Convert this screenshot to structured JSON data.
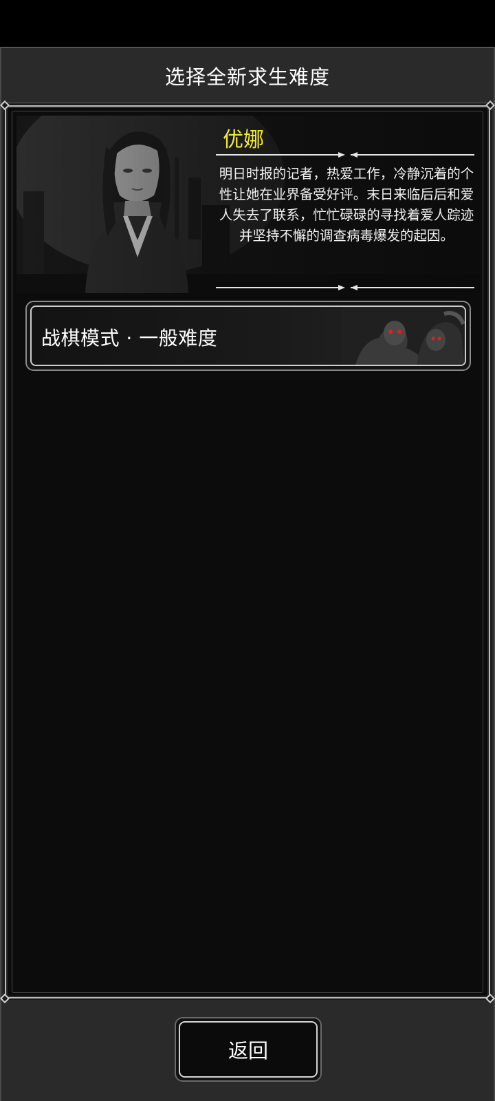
{
  "dialog": {
    "title": "选择全新求生难度"
  },
  "character": {
    "name": "优娜",
    "description": "明日时报的记者，热爱工作，冷静沉着的个性让她在业界备受好评。末日来临后后和爱人失去了联系，忙忙碌碌的寻找着爱人踪迹并坚持不懈的调查病毒爆发的起因。",
    "name_color": "#f4ea3a"
  },
  "modes": [
    {
      "label": "战棋模式 · 一般难度"
    }
  ],
  "footer": {
    "back_label": "返回"
  }
}
